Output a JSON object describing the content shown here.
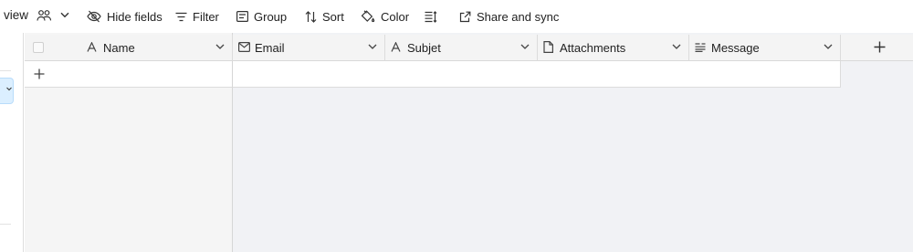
{
  "toolbar": {
    "view_label": "view",
    "items": [
      {
        "label": "Hide fields",
        "icon": "eye-slash-icon"
      },
      {
        "label": "Filter",
        "icon": "filter-icon"
      },
      {
        "label": "Group",
        "icon": "group-icon"
      },
      {
        "label": "Sort",
        "icon": "sort-icon"
      },
      {
        "label": "Color",
        "icon": "paint-bucket-icon"
      },
      {
        "label": "",
        "icon": "row-height-icon"
      },
      {
        "label": "Share and sync",
        "icon": "share-external-icon"
      }
    ]
  },
  "grid": {
    "columns": [
      {
        "label": "Name",
        "icon": "text-field-icon"
      },
      {
        "label": "Email",
        "icon": "email-icon"
      },
      {
        "label": "Subjet",
        "icon": "text-field-icon"
      },
      {
        "label": "Attachments",
        "icon": "document-icon"
      },
      {
        "label": "Message",
        "icon": "long-text-icon"
      }
    ],
    "rows": []
  },
  "colors": {
    "header_bg": "#f4f4f4",
    "grid_bg": "#f1f2f5",
    "frozen_bg": "#f5f5f5",
    "selected_sidebar": "#dbefff"
  }
}
